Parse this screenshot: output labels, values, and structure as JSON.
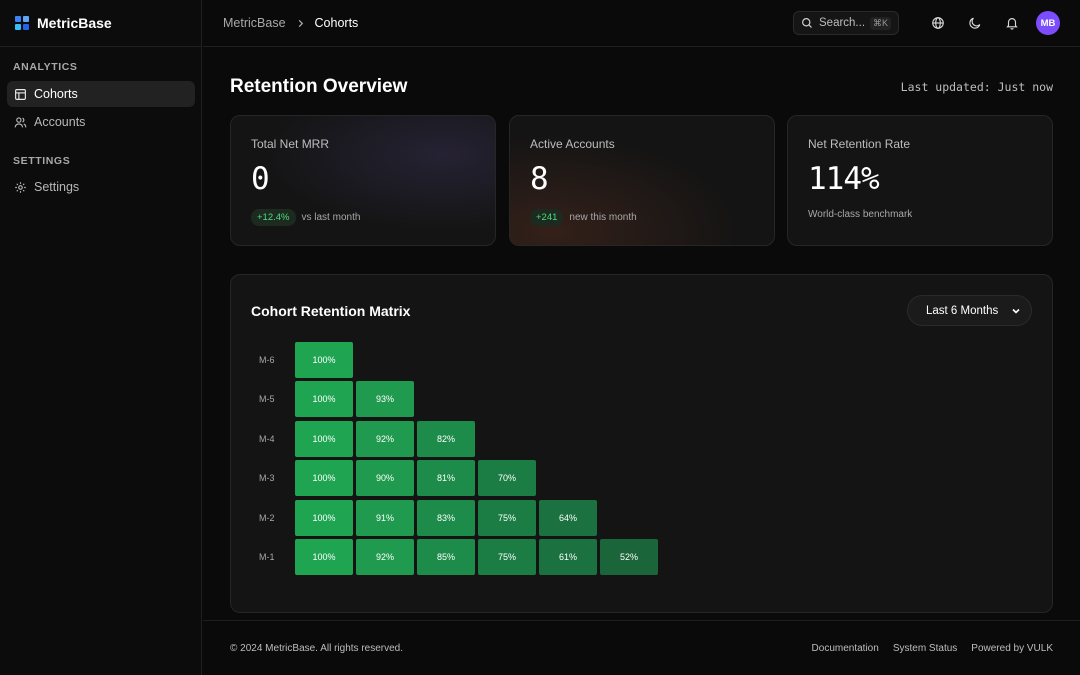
{
  "brand": {
    "name": "MetricBase",
    "logo_colors": [
      "#3b82f6",
      "#60a5fa",
      "#38bdf8",
      "#2563eb"
    ]
  },
  "sidebar": {
    "sections": [
      {
        "heading": "ANALYTICS",
        "items": [
          {
            "label": "Cohorts",
            "icon": "table-icon",
            "active": true
          },
          {
            "label": "Accounts",
            "icon": "users-icon",
            "active": false
          }
        ]
      },
      {
        "heading": "SETTINGS",
        "items": [
          {
            "label": "Settings",
            "icon": "gear-icon",
            "active": false
          }
        ]
      }
    ]
  },
  "topbar": {
    "breadcrumb": {
      "root": "MetricBase",
      "current": "Cohorts"
    },
    "search": {
      "placeholder": "Search...",
      "shortcut": "⌘K"
    },
    "icons": [
      "globe-icon",
      "moon-icon",
      "bell-icon"
    ],
    "avatar_initials": "MB",
    "avatar_color": "#7c4dff"
  },
  "main": {
    "title": "Retention Overview",
    "updated": "Last updated: Just now",
    "cards": [
      {
        "label": "Total Net MRR",
        "value": "0",
        "delta": "+12.4%",
        "delta_note": "vs last month"
      },
      {
        "label": "Active Accounts",
        "value": "8",
        "delta": "+241",
        "delta_note": "new this month"
      },
      {
        "label": "Net Retention Rate",
        "value": "114%",
        "delta": "",
        "delta_note": "World-class benchmark"
      }
    ],
    "matrix": {
      "title": "Cohort Retention Matrix",
      "range": "Last 6 Months",
      "rows": [
        {
          "label": "M-6",
          "values": [
            "100%"
          ]
        },
        {
          "label": "M-5",
          "values": [
            "100%",
            "93%"
          ]
        },
        {
          "label": "M-4",
          "values": [
            "100%",
            "92%",
            "82%"
          ]
        },
        {
          "label": "M-3",
          "values": [
            "100%",
            "90%",
            "81%",
            "70%"
          ]
        },
        {
          "label": "M-2",
          "values": [
            "100%",
            "91%",
            "83%",
            "75%",
            "64%"
          ]
        },
        {
          "label": "M-1",
          "values": [
            "100%",
            "92%",
            "85%",
            "75%",
            "61%",
            "52%"
          ]
        }
      ]
    }
  },
  "footer": {
    "copyright": "© 2024 MetricBase. All rights reserved.",
    "links": [
      "Documentation",
      "System Status",
      "Powered by VULK"
    ]
  },
  "colors": {
    "accent_green": "#4ade80",
    "cell_high": "#1fa552",
    "cell_low": "#1b6a3a"
  }
}
